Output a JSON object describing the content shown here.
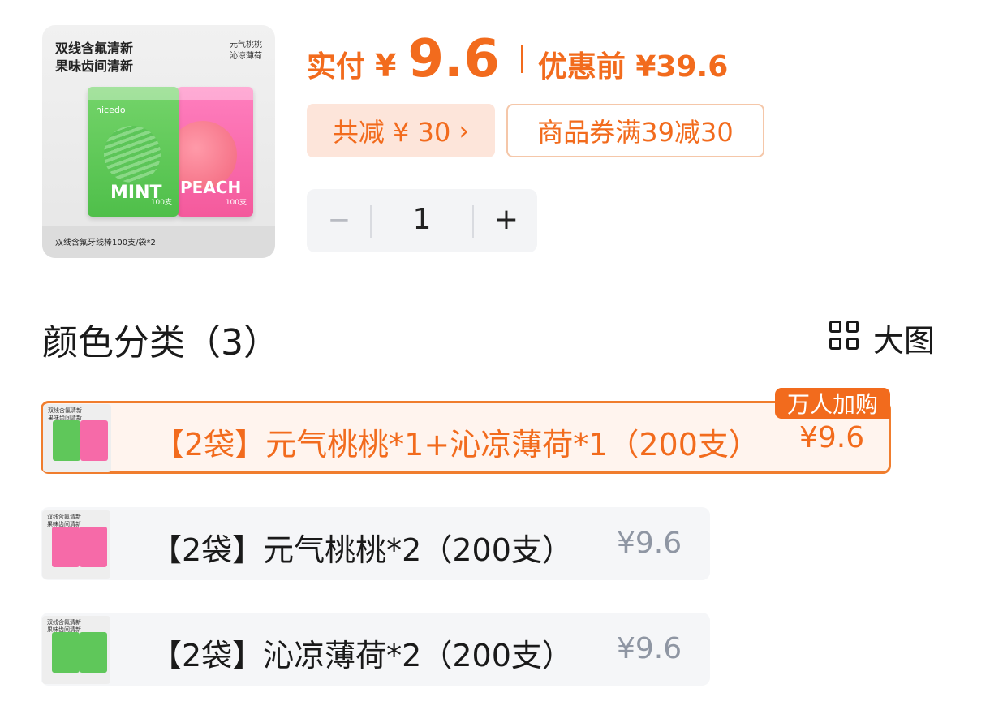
{
  "product_image": {
    "title_line1": "双线含氟清新",
    "title_line2": "果味齿间清新",
    "flavors_line1": "元气桃桃",
    "flavors_line2": "沁凉薄荷",
    "bag_brand": "nicedo",
    "bag_word_green": "MINT",
    "bag_word_pink": "PEACH",
    "bag_count": "100支",
    "footer": "双线含氟牙线棒100支/袋*2"
  },
  "price": {
    "paid_label": "实付",
    "currency": "¥",
    "paid_value": "9.6",
    "original": "优惠前 ¥39.6"
  },
  "discount": {
    "total_label": "共减 ¥ 30",
    "total_arrow": "›",
    "coupon_label": "商品券满39减30"
  },
  "quantity": {
    "minus": "−",
    "value": "1",
    "plus": "+"
  },
  "section": {
    "title": "颜色分类（3）",
    "view_label": "大图"
  },
  "options": [
    {
      "name": "【2袋】元气桃桃*1+沁凉薄荷*1（200支）",
      "price": "¥9.6",
      "badge": "万人加购",
      "selected": true
    },
    {
      "name": "【2袋】元气桃桃*2（200支）",
      "price": "¥9.6",
      "selected": false
    },
    {
      "name": "【2袋】沁凉薄荷*2（200支）",
      "price": "¥9.6",
      "selected": false
    }
  ],
  "colors": {
    "accent": "#f26b1d",
    "accent_bg": "#fde5da",
    "muted": "#8f96a3"
  }
}
